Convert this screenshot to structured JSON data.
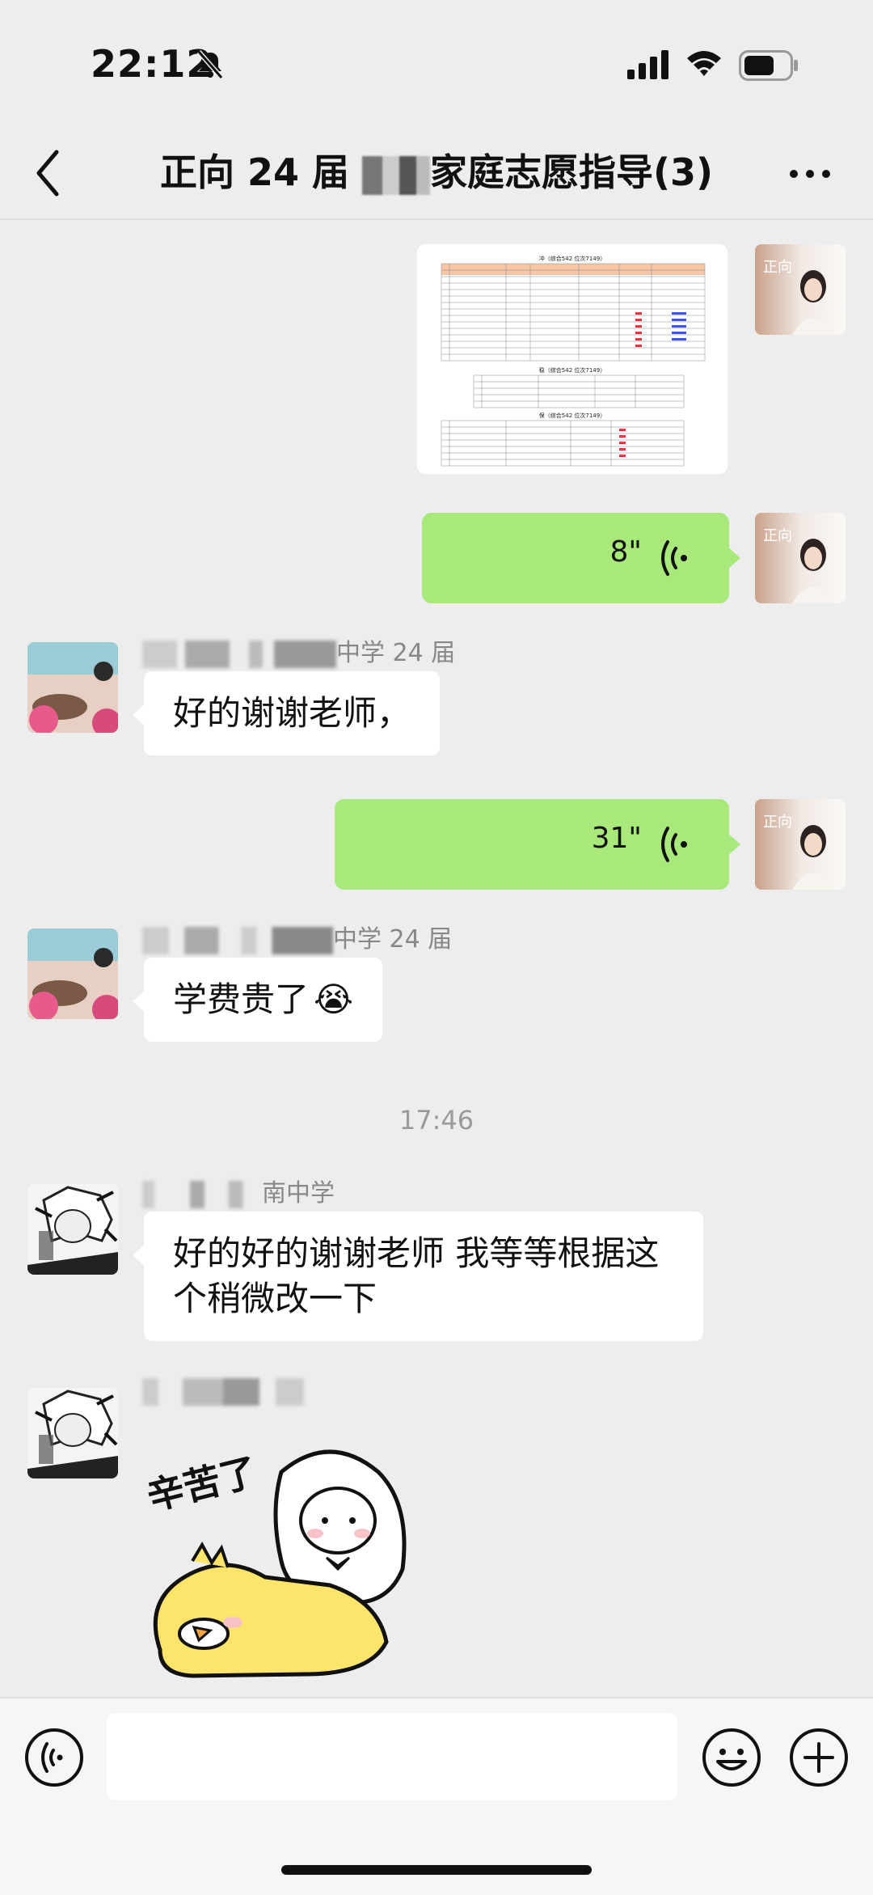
{
  "status_bar": {
    "time": "22:12"
  },
  "header": {
    "title_prefix": "正向 24 届 ",
    "title_suffix": "家庭志愿指导(3)"
  },
  "messages": {
    "voice_1": {
      "duration": "8\""
    },
    "group_1": {
      "sender": "中学 24 届",
      "text": "好的谢谢老师，"
    },
    "voice_2": {
      "duration": "31\""
    },
    "group_2": {
      "sender": "中学 24 届",
      "text": "学费贵了",
      "emoji": "😭"
    },
    "timestamp": "17:46",
    "group_3": {
      "sender": "南中学",
      "text_line1": "好的好的谢谢老师 我等等根据这",
      "text_line2": "个稍微改一下"
    },
    "sticker": {
      "text": "辛苦了"
    }
  },
  "avatar_badge": "正向",
  "preview_table": {
    "title_1": "冲（综合542 位次7149）",
    "title_2": "稳（综合542 位次7149）",
    "title_3": "保（综合542 位次7149）"
  },
  "colors": {
    "bubble_green": "#a9e87a",
    "background": "#ededed"
  }
}
